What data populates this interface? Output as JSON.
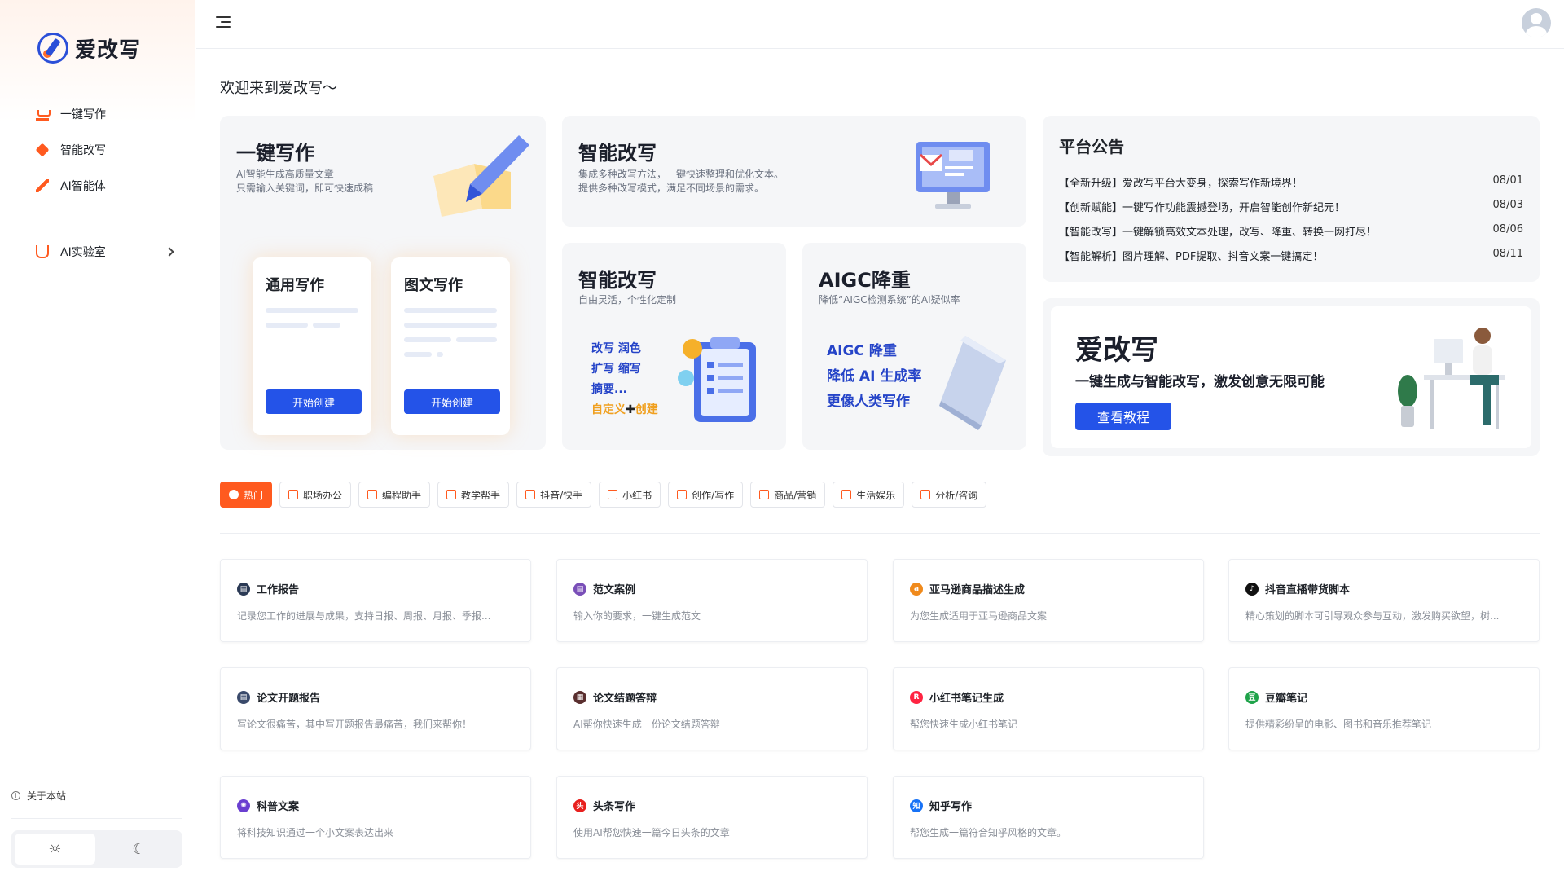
{
  "brand": {
    "name": "爱改写"
  },
  "sidebar": {
    "items": [
      {
        "label": "一键写作",
        "icon": "cart-icon"
      },
      {
        "label": "智能改写",
        "icon": "eraser-icon"
      },
      {
        "label": "AI智能体",
        "icon": "magic-wand-icon"
      }
    ],
    "lab": {
      "label": "AI实验室",
      "icon": "flask-icon"
    },
    "about": "关于本站",
    "theme": {
      "light_icon": "☼",
      "dark_icon": "☾"
    }
  },
  "welcome": "欢迎来到爱改写～",
  "hero": {
    "write": {
      "title": "一键写作",
      "sub1": "AI智能生成高质量文章",
      "sub2": "只需输入关键词，即可快速成稿",
      "general": {
        "title": "通用写作",
        "button": "开始创建"
      },
      "image": {
        "title": "图文写作",
        "button": "开始创建"
      }
    },
    "rewrite_top": {
      "title": "智能改写",
      "sub1": "集成多种改写方法，一键快速整理和优化文本。",
      "sub2": "提供多种改写模式，满足不同场景的需求。"
    },
    "rewrite": {
      "title": "智能改写",
      "sub": "自由灵活，个性化定制",
      "line1": "改写 润色",
      "line2": "扩写 缩写",
      "line3": "摘要...",
      "line4a": "自定义",
      "line4b": "创建"
    },
    "aigc": {
      "title": "AIGC降重",
      "sub": "降低“AIGC检测系统”的AI疑似率",
      "line1": "AIGC 降重",
      "line2": "降低 AI 生成率",
      "line3": "更像人类写作"
    }
  },
  "announcements": {
    "title": "平台公告",
    "items": [
      {
        "text": "【全新升级】爱改写平台大变身，探索写作新境界！",
        "date": "08/01"
      },
      {
        "text": "【创新赋能】一键写作功能震撼登场，开启智能创作新纪元！",
        "date": "08/03"
      },
      {
        "text": "【智能改写】一键解锁高效文本处理，改写、降重、转换一网打尽！",
        "date": "08/06"
      },
      {
        "text": "【智能解析】图片理解、PDF提取、抖音文案一键搞定！",
        "date": "08/11"
      }
    ]
  },
  "promo": {
    "brand": "爱改写",
    "tagline": "一键生成与智能改写，激发创意无限可能",
    "button": "查看教程"
  },
  "categories": [
    {
      "label": "热门",
      "active": true
    },
    {
      "label": "职场办公"
    },
    {
      "label": "编程助手"
    },
    {
      "label": "教学帮手"
    },
    {
      "label": "抖音/快手"
    },
    {
      "label": "小红书"
    },
    {
      "label": "创作/写作"
    },
    {
      "label": "商品/营销"
    },
    {
      "label": "生活娱乐"
    },
    {
      "label": "分析/咨询"
    }
  ],
  "tools": [
    {
      "title": "工作报告",
      "desc": "记录您工作的进展与成果，支持日报、周报、月报、季报...",
      "icon": "report-icon",
      "color": "#2b3a55",
      "glyph": "▤"
    },
    {
      "title": "范文案例",
      "desc": "输入你的要求，一键生成范文",
      "icon": "document-icon",
      "color": "#7a4fb8",
      "glyph": "▤"
    },
    {
      "title": "亚马逊商品描述生成",
      "desc": "为您生成适用于亚马逊商品文案",
      "icon": "amazon-icon",
      "color": "#f08a1c",
      "glyph": "a"
    },
    {
      "title": "抖音直播带货脚本",
      "desc": "精心策划的脚本可引导观众参与互动，激发购买欲望，树...",
      "icon": "douyin-icon",
      "color": "#111111",
      "glyph": "♪"
    },
    {
      "title": "论文开题报告",
      "desc": "写论文很痛苦，其中写开题报告最痛苦，我们来帮你！",
      "icon": "paper-icon",
      "color": "#3a4a6b",
      "glyph": "▤"
    },
    {
      "title": "论文结题答辩",
      "desc": "AI帮你快速生成一份论文结题答辩",
      "icon": "defense-icon",
      "color": "#5a2f2f",
      "glyph": "▦"
    },
    {
      "title": "小红书笔记生成",
      "desc": "帮您快速生成小红书笔记",
      "icon": "xiaohongshu-icon",
      "color": "#ff2442",
      "glyph": "R"
    },
    {
      "title": "豆瓣笔记",
      "desc": "提供精彩纷呈的电影、图书和音乐推荐笔记",
      "icon": "douban-icon",
      "color": "#1fa34a",
      "glyph": "豆"
    },
    {
      "title": "科普文案",
      "desc": "将科技知识通过一个小文案表达出来",
      "icon": "science-icon",
      "color": "#6a3fd0",
      "glyph": "✺"
    },
    {
      "title": "头条写作",
      "desc": "使用AI帮您快速一篇今日头条的文章",
      "icon": "toutiao-icon",
      "color": "#e8201e",
      "glyph": "头"
    },
    {
      "title": "知乎写作",
      "desc": "帮您生成一篇符合知乎风格的文章。",
      "icon": "zhihu-icon",
      "color": "#1772f6",
      "glyph": "知"
    }
  ],
  "colors": {
    "accent": "#ff5a1f",
    "primary": "#2453e8",
    "brand_blue": "#2544c8"
  }
}
